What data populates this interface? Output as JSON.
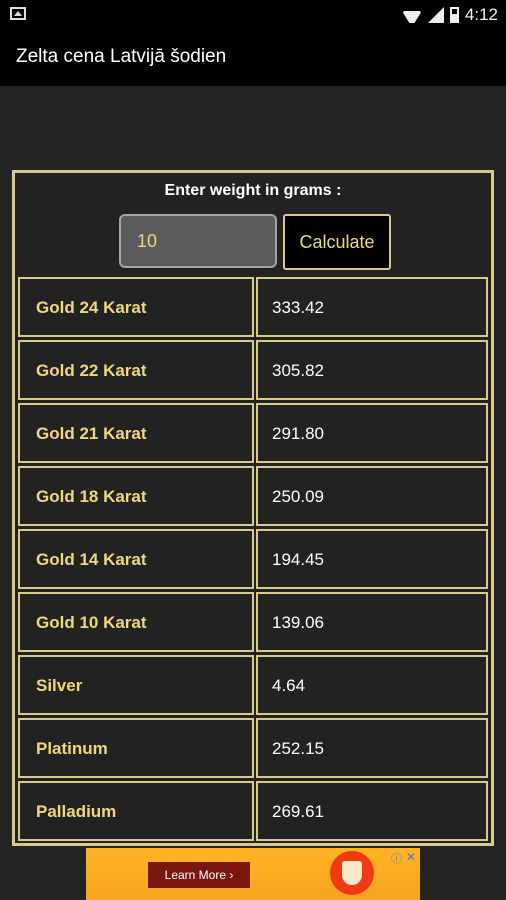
{
  "status_bar": {
    "time": "4:12"
  },
  "app_bar": {
    "title": "Zelta cena Latvijā šodien"
  },
  "form": {
    "prompt": "Enter weight in grams :",
    "weight_value": "10",
    "calculate_label": "Calculate"
  },
  "prices": [
    {
      "metal": "Gold 24 Karat",
      "price": "333.42"
    },
    {
      "metal": "Gold 22 Karat",
      "price": "305.82"
    },
    {
      "metal": "Gold 21 Karat",
      "price": "291.80"
    },
    {
      "metal": "Gold 18 Karat",
      "price": "250.09"
    },
    {
      "metal": "Gold 14 Karat",
      "price": "194.45"
    },
    {
      "metal": "Gold 10 Karat",
      "price": "139.06"
    },
    {
      "metal": "Silver",
      "price": "4.64"
    },
    {
      "metal": "Platinum",
      "price": "252.15"
    },
    {
      "metal": "Palladium",
      "price": "269.61"
    }
  ],
  "ad": {
    "button_label": "Learn More ›",
    "info_icon": "ⓘ",
    "close_icon": "✕"
  },
  "colors": {
    "accent_gold": "#f0d77a",
    "border_gold": "#d9c98a",
    "background": "#232323"
  }
}
